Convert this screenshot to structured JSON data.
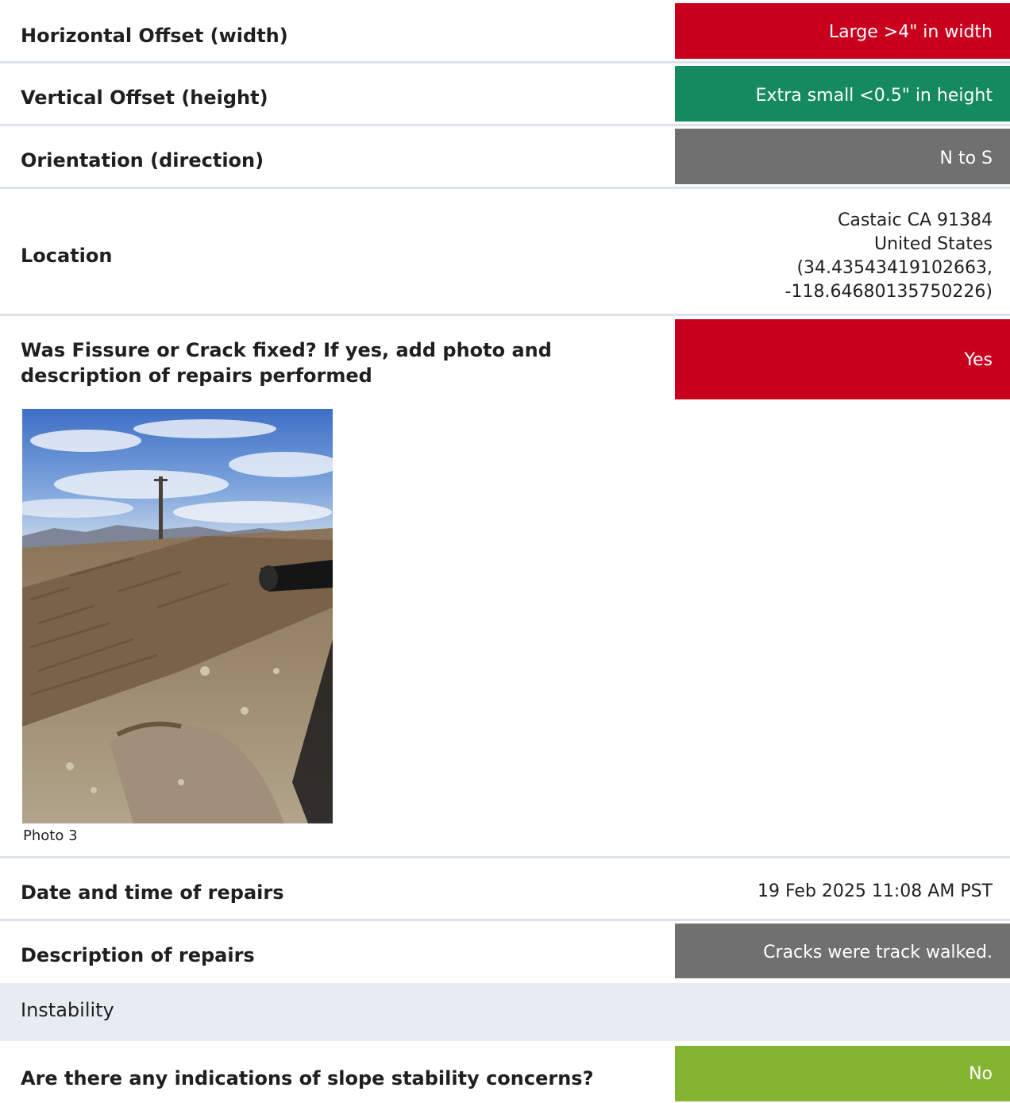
{
  "rows": {
    "horizontal": {
      "label": "Horizontal Offset (width)",
      "value": "Large >4\" in width",
      "color": "#c8001e"
    },
    "vertical": {
      "label": "Vertical Offset (height)",
      "value": "Extra small <0.5\" in height",
      "color": "#158a5e"
    },
    "orientation": {
      "label": "Orientation (direction)",
      "value": "N to S",
      "color": "#707070"
    },
    "location": {
      "label": "Location",
      "lines": [
        "Castaic CA 91384",
        "United States",
        "(34.43543419102663,",
        "-118.64680135750226)"
      ]
    },
    "fixed": {
      "label": "Was Fissure or Crack fixed? If yes, add photo and description of repairs performed",
      "value": "Yes",
      "color": "#c8001e"
    },
    "photo": {
      "caption": "Photo 3"
    },
    "date": {
      "label": "Date and time of repairs",
      "value": "19 Feb 2025 11:08 AM PST"
    },
    "description": {
      "label": "Description of repairs",
      "value": "Cracks were track walked.",
      "color": "#707070"
    }
  },
  "section": {
    "title": "Instability"
  },
  "slope": {
    "label": "Are there any indications of slope stability concerns?",
    "value": "No",
    "color": "#82b431"
  }
}
